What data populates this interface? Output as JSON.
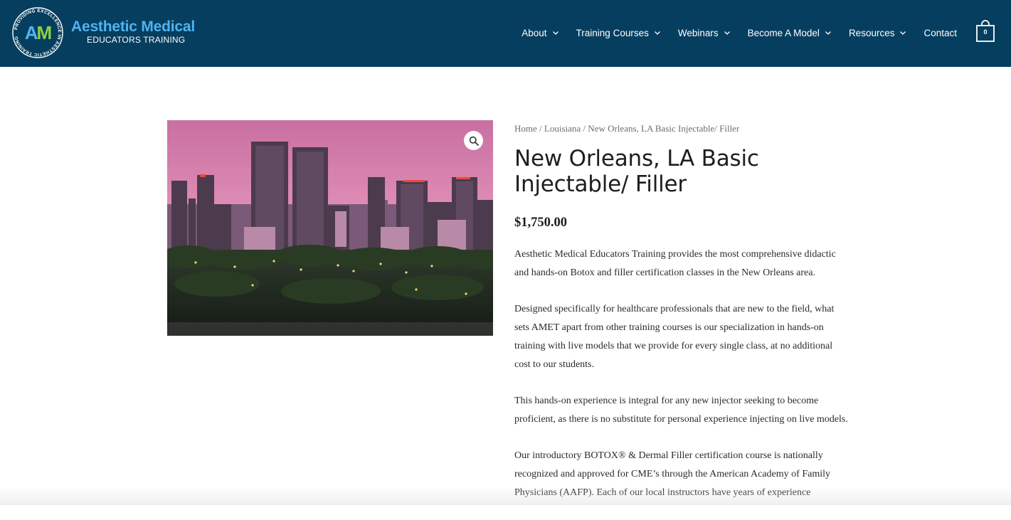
{
  "header": {
    "logo": {
      "initials": "AM",
      "ring_text": "PROVIDING EXCELLENCE IN AESTHETIC TRAINING",
      "title": "Aesthetic Medical",
      "subtitle": "EDUCATORS TRAINING"
    },
    "nav": [
      {
        "label": "About",
        "has_dropdown": true
      },
      {
        "label": "Training Courses",
        "has_dropdown": true
      },
      {
        "label": "Webinars",
        "has_dropdown": true
      },
      {
        "label": "Become A Model",
        "has_dropdown": true
      },
      {
        "label": "Resources",
        "has_dropdown": true
      },
      {
        "label": "Contact",
        "has_dropdown": false
      }
    ],
    "cart_count": "0"
  },
  "breadcrumb": {
    "home": "Home",
    "category": "Louisiana",
    "current": "New Orleans, LA Basic Injectable/ Filler",
    "separator": " / "
  },
  "product": {
    "title": "New Orleans, LA Basic Injectable/ Filler",
    "price": "$1,750.00",
    "description": [
      "Aesthetic Medical Educators Training provides the most comprehensive didactic and hands-on Botox and filler certification classes in the New Orleans area.",
      "Designed specifically for healthcare professionals that are new to the field, what sets AMET apart from other training courses is our specialization in hands-on training with live models that we provide for every single class, at no additional cost to our students.",
      "This hands-on experience is integral for any new injector seeking to become proficient, as there is no substitute for personal experience injecting on live models.",
      "Our introductory BOTOX® & Dermal Filler certification course is nationally recognized and approved for CME’s through the American Academy of Family Physicians (AAFP). Each of our local instructors have years of experience"
    ]
  },
  "icons": {
    "zoom": "magnifier-icon",
    "cart": "shopping-bag-icon",
    "dropdown": "chevron-down-icon"
  },
  "colors": {
    "header_bg": "#063e5f",
    "logo_blue": "#4fb3f0",
    "logo_green": "#8bd23f",
    "text": "#1e1e1e"
  }
}
